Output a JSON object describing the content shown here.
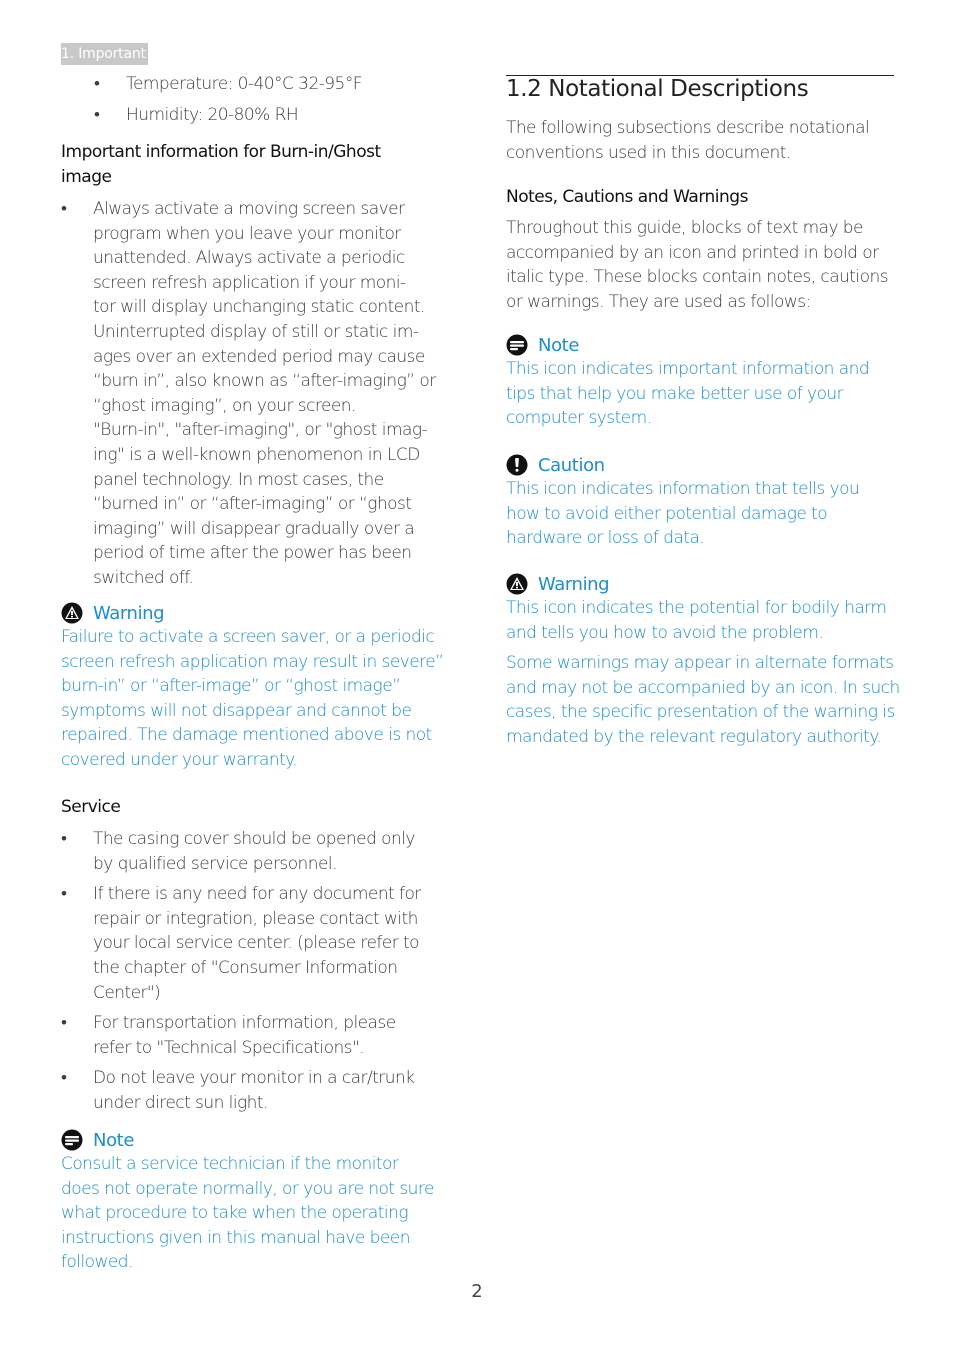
{
  "header": {
    "chapter_tag": "1. Important"
  },
  "left": {
    "env_bullets": [
      "Temperature: 0-40°C 32-95°F",
      "Humidity: 20-80% RH"
    ],
    "burnin": {
      "heading_line1": "Important information for Burn-in/Ghost",
      "heading_line2": "image",
      "bullet_lines": [
        "Always activate a moving screen saver",
        "program when you leave your monitor",
        "unattended. Always activate a periodic",
        "screen refresh application if your moni-",
        "tor will display unchanging static content.",
        "Uninterrupted display of still or static im-",
        "ages over an extended period may cause",
        "“burn in”, also known as “after-imaging” or",
        "“ghost imaging”, on your screen.",
        "\"Burn-in\", \"after-imaging\", or \"ghost imag-",
        "ing\" is a well-known phenomenon in LCD",
        "panel technology. In most cases, the",
        "“burned in” or “after-imaging” or “ghost",
        "imaging” will disappear gradually over a",
        "period of time after the power has been",
        "switched off."
      ]
    },
    "warning": {
      "title": "Warning",
      "icon": "warning-triangle-icon",
      "lines": [
        "Failure to activate a screen saver, or a periodic",
        "screen refresh application may result in severe”",
        "burn-in” or “after-image” or “ghost image”",
        "symptoms will not disappear and cannot be",
        "repaired. The damage mentioned above is not",
        "covered under your warranty."
      ]
    },
    "service": {
      "heading": "Service",
      "bullets": [
        [
          "The casing cover should be opened only",
          "by qualified service personnel."
        ],
        [
          "If there is any need for any document for",
          "repair or integration, please contact with",
          "your local service center. (please refer to",
          "the chapter of \"Consumer Information",
          "Center\")"
        ],
        [
          "For transportation information, please",
          "refer to \"Technical Specifications\"."
        ],
        [
          "Do not leave your monitor in a car/trunk",
          "under direct sun light."
        ]
      ]
    },
    "note": {
      "title": "Note",
      "icon": "note-icon",
      "lines": [
        "Consult a service technician if the monitor",
        "does not operate normally, or you are not sure",
        "what procedure to take when the operating",
        "instructions given in this manual have been",
        "followed."
      ]
    }
  },
  "right": {
    "section_title": "1.2  Notational Descriptions",
    "intro_lines": [
      "The following subsections describe notational",
      "conventions used in this document."
    ],
    "subheading": "Notes, Cautions and Warnings",
    "para_lines": [
      "Throughout this guide, blocks of text may be",
      "accompanied by an icon and printed in bold or",
      "italic type. These blocks contain notes, cautions",
      "or warnings. They are used as follows:"
    ],
    "note": {
      "title": "Note",
      "icon": "note-icon",
      "lines": [
        "This icon indicates important information and",
        "tips that help you make better use of your",
        "computer system."
      ]
    },
    "caution": {
      "title": "Caution",
      "icon": "caution-icon",
      "lines": [
        "This icon indicates information that tells you",
        "how to avoid either potential damage to",
        "hardware or loss of data."
      ]
    },
    "warning": {
      "title": "Warning",
      "icon": "warning-triangle-icon",
      "lines": [
        "This icon indicates the potential for bodily harm",
        "and tells you how to avoid the problem."
      ],
      "extra_lines": [
        "Some warnings may appear in alternate formats",
        "and may not be accompanied by an icon. In such",
        "cases, the specific presentation of the warning is",
        "mandated by the relevant regulatory authority."
      ]
    }
  },
  "footer": {
    "page_number": "2"
  },
  "colors": {
    "accent_blue": "#1a8ed0",
    "tag_gray": "#c8c8c8",
    "body_text": "#3d3d3d"
  }
}
